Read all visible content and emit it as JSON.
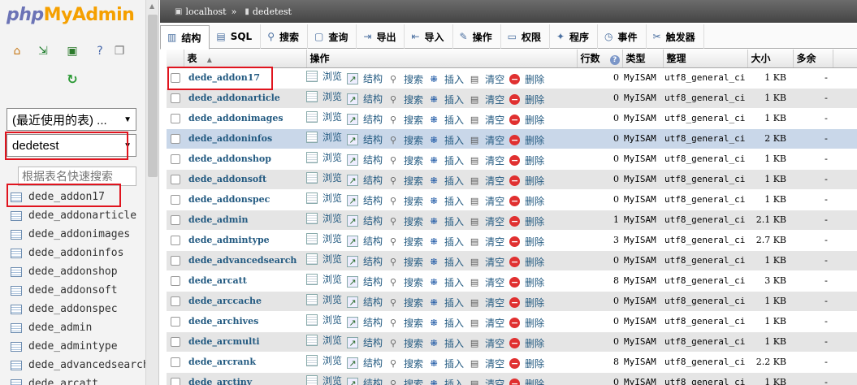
{
  "nav": {
    "logo_php": "php",
    "logo_myadmin": "MyAdmin",
    "icons": [
      "home-icon",
      "exit-icon",
      "query-window-icon",
      "docs-icon",
      "copy-icon"
    ],
    "recent_select": "(最近使用的表) ...",
    "db_select": "dedetest",
    "filter_placeholder": "根据表名快速搜索",
    "tables": [
      "dede_addon17",
      "dede_addonarticle",
      "dede_addonimages",
      "dede_addoninfos",
      "dede_addonshop",
      "dede_addonsoft",
      "dede_addonspec",
      "dede_admin",
      "dede_admintype",
      "dede_advancedsearch",
      "dede_arcatt"
    ]
  },
  "breadcrumb": {
    "server": "localhost",
    "sep": "»",
    "database": "dedetest"
  },
  "tabs": [
    {
      "icon": "structure-icon",
      "glyph": "▥",
      "label": "结构"
    },
    {
      "icon": "sql-icon",
      "glyph": "▤",
      "label": "SQL"
    },
    {
      "icon": "search-icon",
      "glyph": "⚲",
      "label": "搜索"
    },
    {
      "icon": "query-icon",
      "glyph": "▢",
      "label": "查询"
    },
    {
      "icon": "export-icon",
      "glyph": "⇥",
      "label": "导出"
    },
    {
      "icon": "import-icon",
      "glyph": "⇤",
      "label": "导入"
    },
    {
      "icon": "operations-icon",
      "glyph": "✎",
      "label": "操作"
    },
    {
      "icon": "privileges-icon",
      "glyph": "▭",
      "label": "权限"
    },
    {
      "icon": "routines-icon",
      "glyph": "✦",
      "label": "程序"
    },
    {
      "icon": "events-icon",
      "glyph": "◷",
      "label": "事件"
    },
    {
      "icon": "triggers-icon",
      "glyph": "✂",
      "label": "触发器"
    }
  ],
  "table_header": {
    "table": "表",
    "sort_arrow": "▲",
    "action": "操作",
    "rows": "行数",
    "rows_help": "?",
    "type": "类型",
    "collation": "整理",
    "size": "大小",
    "overhead": "多余"
  },
  "actions": {
    "browse": "浏览",
    "structure": "结构",
    "search": "搜索",
    "insert": "插入",
    "empty": "清空",
    "drop": "删除"
  },
  "rows": [
    {
      "name": "dede_addon17",
      "rows": "0",
      "type": "MyISAM",
      "collation": "utf8_general_ci",
      "size": "1 KB",
      "overhead": "-"
    },
    {
      "name": "dede_addonarticle",
      "rows": "0",
      "type": "MyISAM",
      "collation": "utf8_general_ci",
      "size": "1 KB",
      "overhead": "-"
    },
    {
      "name": "dede_addonimages",
      "rows": "0",
      "type": "MyISAM",
      "collation": "utf8_general_ci",
      "size": "1 KB",
      "overhead": "-"
    },
    {
      "name": "dede_addoninfos",
      "rows": "0",
      "type": "MyISAM",
      "collation": "utf8_general_ci",
      "size": "2 KB",
      "overhead": "-"
    },
    {
      "name": "dede_addonshop",
      "rows": "0",
      "type": "MyISAM",
      "collation": "utf8_general_ci",
      "size": "1 KB",
      "overhead": "-"
    },
    {
      "name": "dede_addonsoft",
      "rows": "0",
      "type": "MyISAM",
      "collation": "utf8_general_ci",
      "size": "1 KB",
      "overhead": "-"
    },
    {
      "name": "dede_addonspec",
      "rows": "0",
      "type": "MyISAM",
      "collation": "utf8_general_ci",
      "size": "1 KB",
      "overhead": "-"
    },
    {
      "name": "dede_admin",
      "rows": "1",
      "type": "MyISAM",
      "collation": "utf8_general_ci",
      "size": "2.1 KB",
      "overhead": "-"
    },
    {
      "name": "dede_admintype",
      "rows": "3",
      "type": "MyISAM",
      "collation": "utf8_general_ci",
      "size": "2.7 KB",
      "overhead": "-"
    },
    {
      "name": "dede_advancedsearch",
      "rows": "0",
      "type": "MyISAM",
      "collation": "utf8_general_ci",
      "size": "1 KB",
      "overhead": "-"
    },
    {
      "name": "dede_arcatt",
      "rows": "8",
      "type": "MyISAM",
      "collation": "utf8_general_ci",
      "size": "3 KB",
      "overhead": "-"
    },
    {
      "name": "dede_arccache",
      "rows": "0",
      "type": "MyISAM",
      "collation": "utf8_general_ci",
      "size": "1 KB",
      "overhead": "-"
    },
    {
      "name": "dede_archives",
      "rows": "0",
      "type": "MyISAM",
      "collation": "utf8_general_ci",
      "size": "1 KB",
      "overhead": "-"
    },
    {
      "name": "dede_arcmulti",
      "rows": "0",
      "type": "MyISAM",
      "collation": "utf8_general_ci",
      "size": "1 KB",
      "overhead": "-"
    },
    {
      "name": "dede_arcrank",
      "rows": "8",
      "type": "MyISAM",
      "collation": "utf8_general_ci",
      "size": "2.2 KB",
      "overhead": "-"
    },
    {
      "name": "dede_arctiny",
      "rows": "0",
      "type": "MyISAM",
      "collation": "utf8_general_ci",
      "size": "1 KB",
      "overhead": "-"
    }
  ],
  "colors": {
    "link": "#235a81",
    "highlight_row": "#c9d7e9",
    "annotation": "#e0141e"
  }
}
